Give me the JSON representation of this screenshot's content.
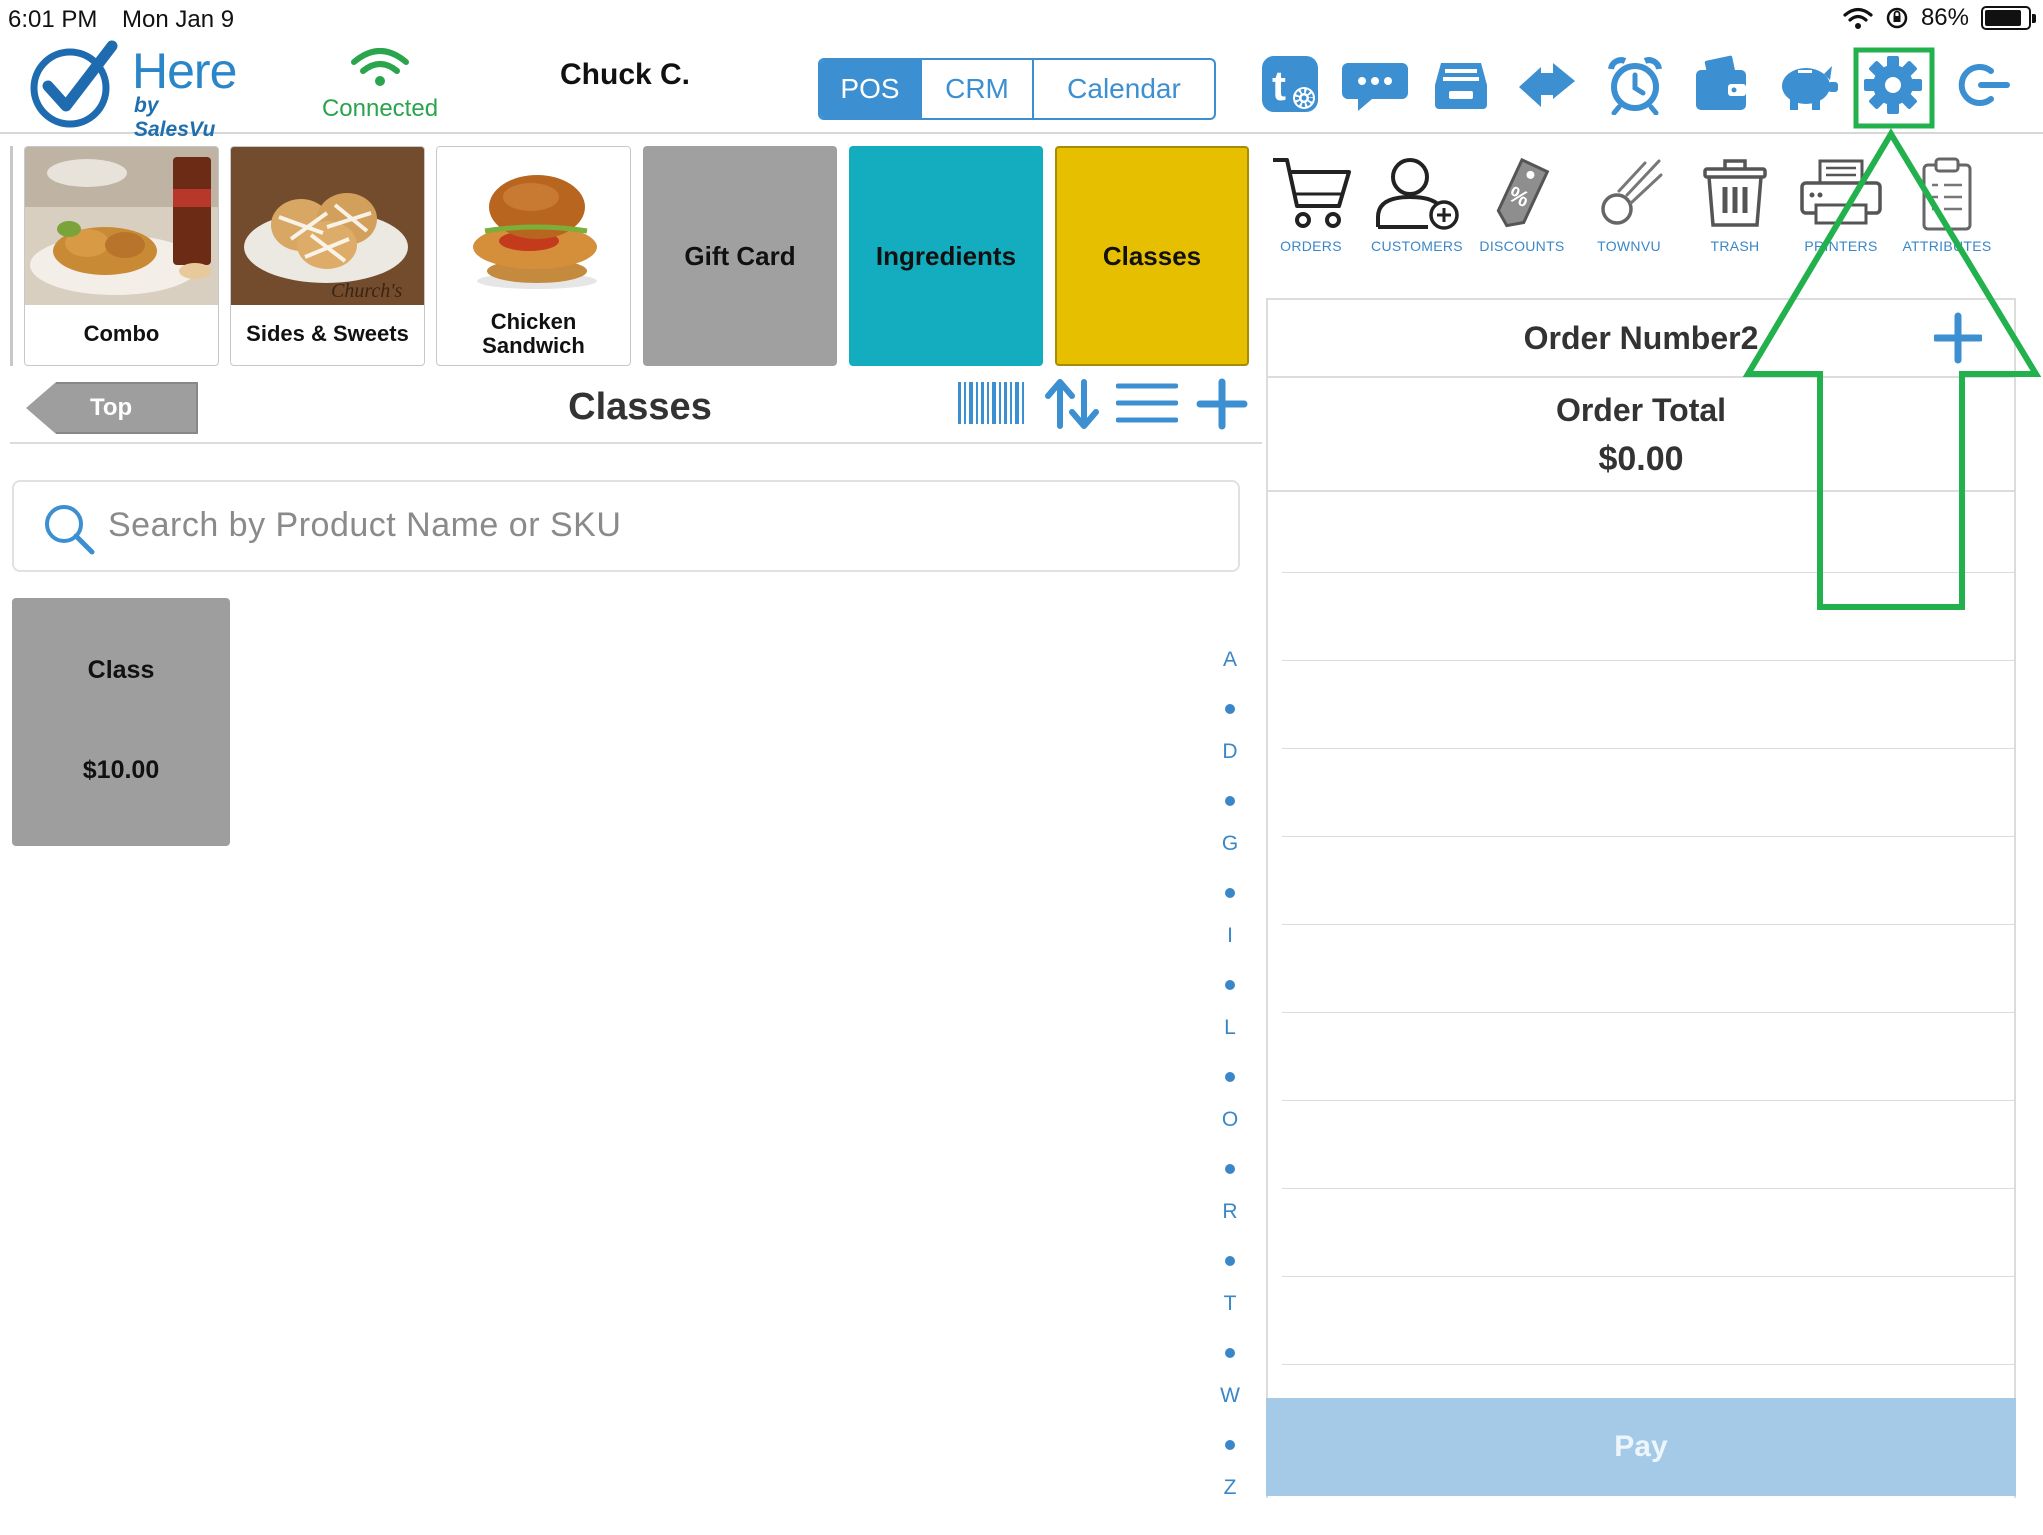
{
  "status_bar": {
    "time": "6:01 PM",
    "date": "Mon Jan 9",
    "battery": "86%",
    "battery_level": 0.86
  },
  "header": {
    "brand": "Here",
    "brand_sub": "by SalesVu",
    "connection": "Connected",
    "user": "Chuck C.",
    "tabs": [
      {
        "label": "POS",
        "active": true
      },
      {
        "label": "CRM",
        "active": false
      },
      {
        "label": "Calendar",
        "active": false
      }
    ],
    "icons": [
      "townvu-settings-icon",
      "chat-icon",
      "cash-drawer-icon",
      "transfer-icon",
      "alarm-clock-icon",
      "wallet-icon",
      "piggy-bank-icon",
      "gear-icon",
      "logout-icon"
    ]
  },
  "categories": [
    {
      "label": "Combo",
      "image": "combo-photo"
    },
    {
      "label": "Sides & Sweets",
      "image": "sides-photo"
    },
    {
      "label": "Chicken Sandwich",
      "image": "sandwich-photo"
    },
    {
      "label": "Gift Card",
      "color": "#a0a0a0"
    },
    {
      "label": "Ingredients",
      "color": "#14adbf"
    },
    {
      "label": "Classes",
      "color": "#e6c000"
    }
  ],
  "actions": [
    {
      "label": "ORDERS",
      "icon": "cart-icon"
    },
    {
      "label": "CUSTOMERS",
      "icon": "add-customer-icon"
    },
    {
      "label": "DISCOUNTS",
      "icon": "discount-tag-icon"
    },
    {
      "label": "TOWNVU",
      "icon": "comet-icon"
    },
    {
      "label": "TRASH",
      "icon": "trash-icon"
    },
    {
      "label": "PRINTERS",
      "icon": "printer-icon"
    },
    {
      "label": "ATTRIBUTES",
      "icon": "clipboard-icon"
    }
  ],
  "nav": {
    "top_label": "Top",
    "section_title": "Classes"
  },
  "search": {
    "placeholder": "Search by Product Name or SKU"
  },
  "products": [
    {
      "name": "Class",
      "price": "$10.00"
    }
  ],
  "alpha_index": [
    "A",
    "D",
    "G",
    "I",
    "L",
    "O",
    "R",
    "T",
    "W",
    "Z"
  ],
  "order": {
    "title": "Order Number2",
    "total_label": "Order Total",
    "total_value": "$0.00",
    "pay_label": "Pay"
  },
  "colors": {
    "accent": "#3c8fd1",
    "highlight": "#22b14c",
    "connected": "#2aa44d",
    "pay": "#a4cae8"
  }
}
